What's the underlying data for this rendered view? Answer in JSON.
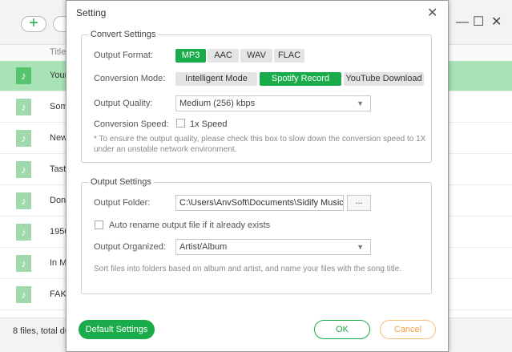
{
  "background": {
    "add_label": "+",
    "column_title": "Title",
    "window_controls": [
      "—",
      "☐",
      "✕"
    ],
    "rows": [
      {
        "title": "Your",
        "selected": true
      },
      {
        "title": "Som",
        "selected": false
      },
      {
        "title": "New",
        "selected": false
      },
      {
        "title": "Tast",
        "selected": false
      },
      {
        "title": "Don",
        "selected": false
      },
      {
        "title": "1950",
        "selected": false
      },
      {
        "title": "In M",
        "selected": false
      },
      {
        "title": "FAKI",
        "selected": false
      }
    ],
    "footer": "8 files, total du",
    "music_icon": "♪"
  },
  "dialog": {
    "title": "Setting",
    "close_icon": "✕",
    "convert": {
      "legend": "Convert Settings",
      "format_label": "Output Format:",
      "formats": [
        "MP3",
        "AAC",
        "WAV",
        "FLAC"
      ],
      "selected_format": "MP3",
      "mode_label": "Conversion Mode:",
      "modes": [
        "Intelligent Mode",
        "Spotify Record",
        "YouTube Download"
      ],
      "selected_mode": "Spotify Record",
      "quality_label": "Output Quality:",
      "quality_value": "Medium (256) kbps",
      "speed_label": "Conversion Speed:",
      "speed_option": "1x Speed",
      "note": "* To ensure the output quality, please check this box to slow down the conversion speed to 1X under an unstable network environment."
    },
    "output": {
      "legend": "Output Settings",
      "folder_label": "Output Folder:",
      "folder_value": "C:\\Users\\AnvSoft\\Documents\\Sidify Music Converter",
      "browse_label": "...",
      "rename_label": "Auto rename output file if it already exists",
      "organized_label": "Output Organized:",
      "organized_value": "Artist/Album",
      "hint": "Sort files into folders based on album and artist, and name your files with the song title."
    },
    "buttons": {
      "default": "Default Settings",
      "ok": "OK",
      "cancel": "Cancel"
    },
    "colors": {
      "accent": "#1aac4b",
      "cancel": "#f0a343"
    }
  }
}
